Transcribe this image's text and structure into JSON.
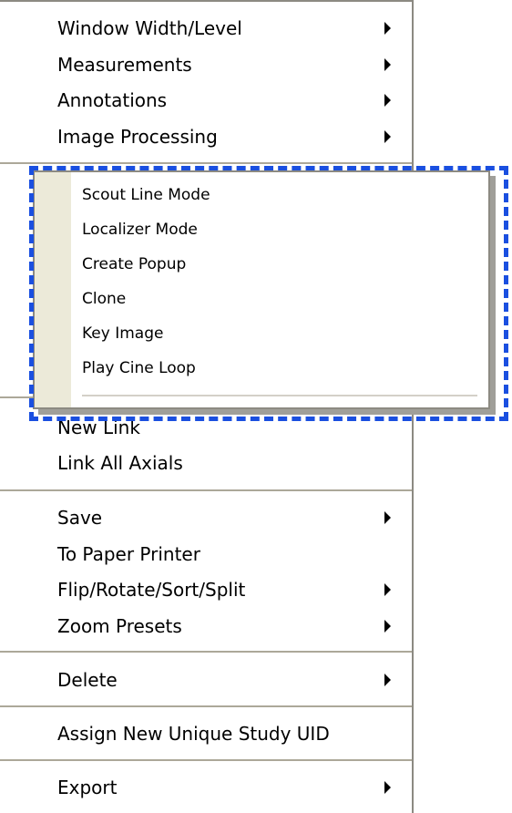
{
  "main_menu": {
    "items": [
      {
        "label": "Window Width/Level",
        "has_submenu": true
      },
      {
        "label": "Measurements",
        "has_submenu": true
      },
      {
        "label": "Annotations",
        "has_submenu": true
      },
      {
        "label": "Image Processing",
        "has_submenu": true
      },
      {
        "label": "New Link",
        "has_submenu": false
      },
      {
        "label": "Link All Axials",
        "has_submenu": false
      },
      {
        "label": "Save",
        "has_submenu": true
      },
      {
        "label": "To Paper Printer",
        "has_submenu": false
      },
      {
        "label": "Flip/Rotate/Sort/Split",
        "has_submenu": true
      },
      {
        "label": "Zoom Presets",
        "has_submenu": true
      },
      {
        "label": "Delete",
        "has_submenu": true
      },
      {
        "label": "Assign New Unique Study UID",
        "has_submenu": false
      },
      {
        "label": "Export",
        "has_submenu": true
      }
    ]
  },
  "sub_menu": {
    "items": [
      {
        "label": "Scout Line Mode"
      },
      {
        "label": "Localizer Mode"
      },
      {
        "label": "Create Popup"
      },
      {
        "label": "Clone"
      },
      {
        "label": "Key Image"
      },
      {
        "label": "Play Cine Loop"
      }
    ]
  },
  "colors": {
    "highlight_border": "#1a4fe0",
    "menu_border": "#8c8a82",
    "gutter": "#ecead9"
  }
}
